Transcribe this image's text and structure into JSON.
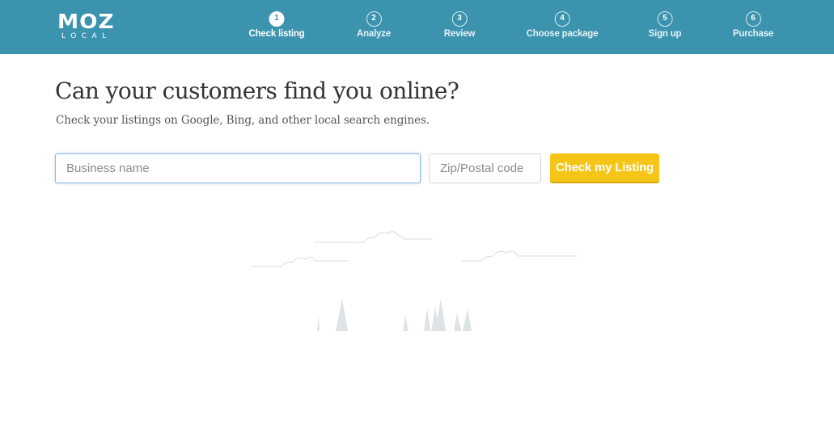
{
  "brand": {
    "name": "MOZ",
    "sub": "LOCAL"
  },
  "steps": [
    {
      "num": "1",
      "label": "Check listing",
      "active": true
    },
    {
      "num": "2",
      "label": "Analyze",
      "active": false
    },
    {
      "num": "3",
      "label": "Review",
      "active": false
    },
    {
      "num": "4",
      "label": "Choose package",
      "active": false
    },
    {
      "num": "5",
      "label": "Sign up",
      "active": false
    },
    {
      "num": "6",
      "label": "Purchase",
      "active": false
    }
  ],
  "main": {
    "title": "Can your customers find you online?",
    "subtitle": "Check your listings on Google, Bing, and other local search engines."
  },
  "form": {
    "business_placeholder": "Business name",
    "business_value": "",
    "zip_placeholder": "Zip/Postal code",
    "zip_value": "",
    "submit_label": "Check my Listing"
  },
  "colors": {
    "header": "#3b93ae",
    "button": "#f5c518",
    "illustration": "#d5dde0"
  },
  "illustration": {
    "icons": [
      "cloud-icon",
      "tree-icon"
    ]
  }
}
